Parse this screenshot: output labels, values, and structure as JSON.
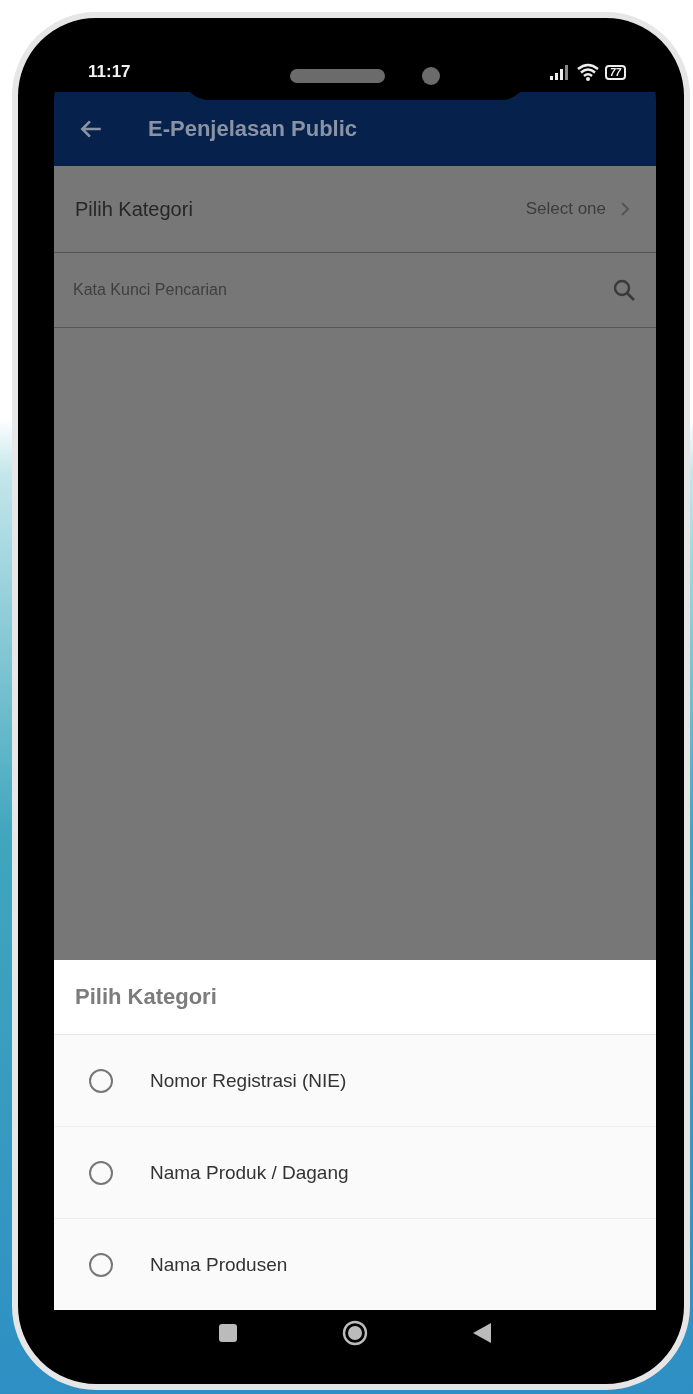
{
  "status_bar": {
    "time": "11:17",
    "battery": "77"
  },
  "app_bar": {
    "title": "E-Penjelasan Public"
  },
  "category_row": {
    "label": "Pilih Kategori",
    "value": "Select one"
  },
  "search": {
    "placeholder": "Kata Kunci Pencarian"
  },
  "sheet": {
    "title": "Pilih Kategori",
    "options": [
      {
        "label": "Nomor Registrasi (NIE)",
        "selected": false
      },
      {
        "label": "Nama Produk / Dagang",
        "selected": false
      },
      {
        "label": "Nama Produsen",
        "selected": false
      }
    ]
  }
}
